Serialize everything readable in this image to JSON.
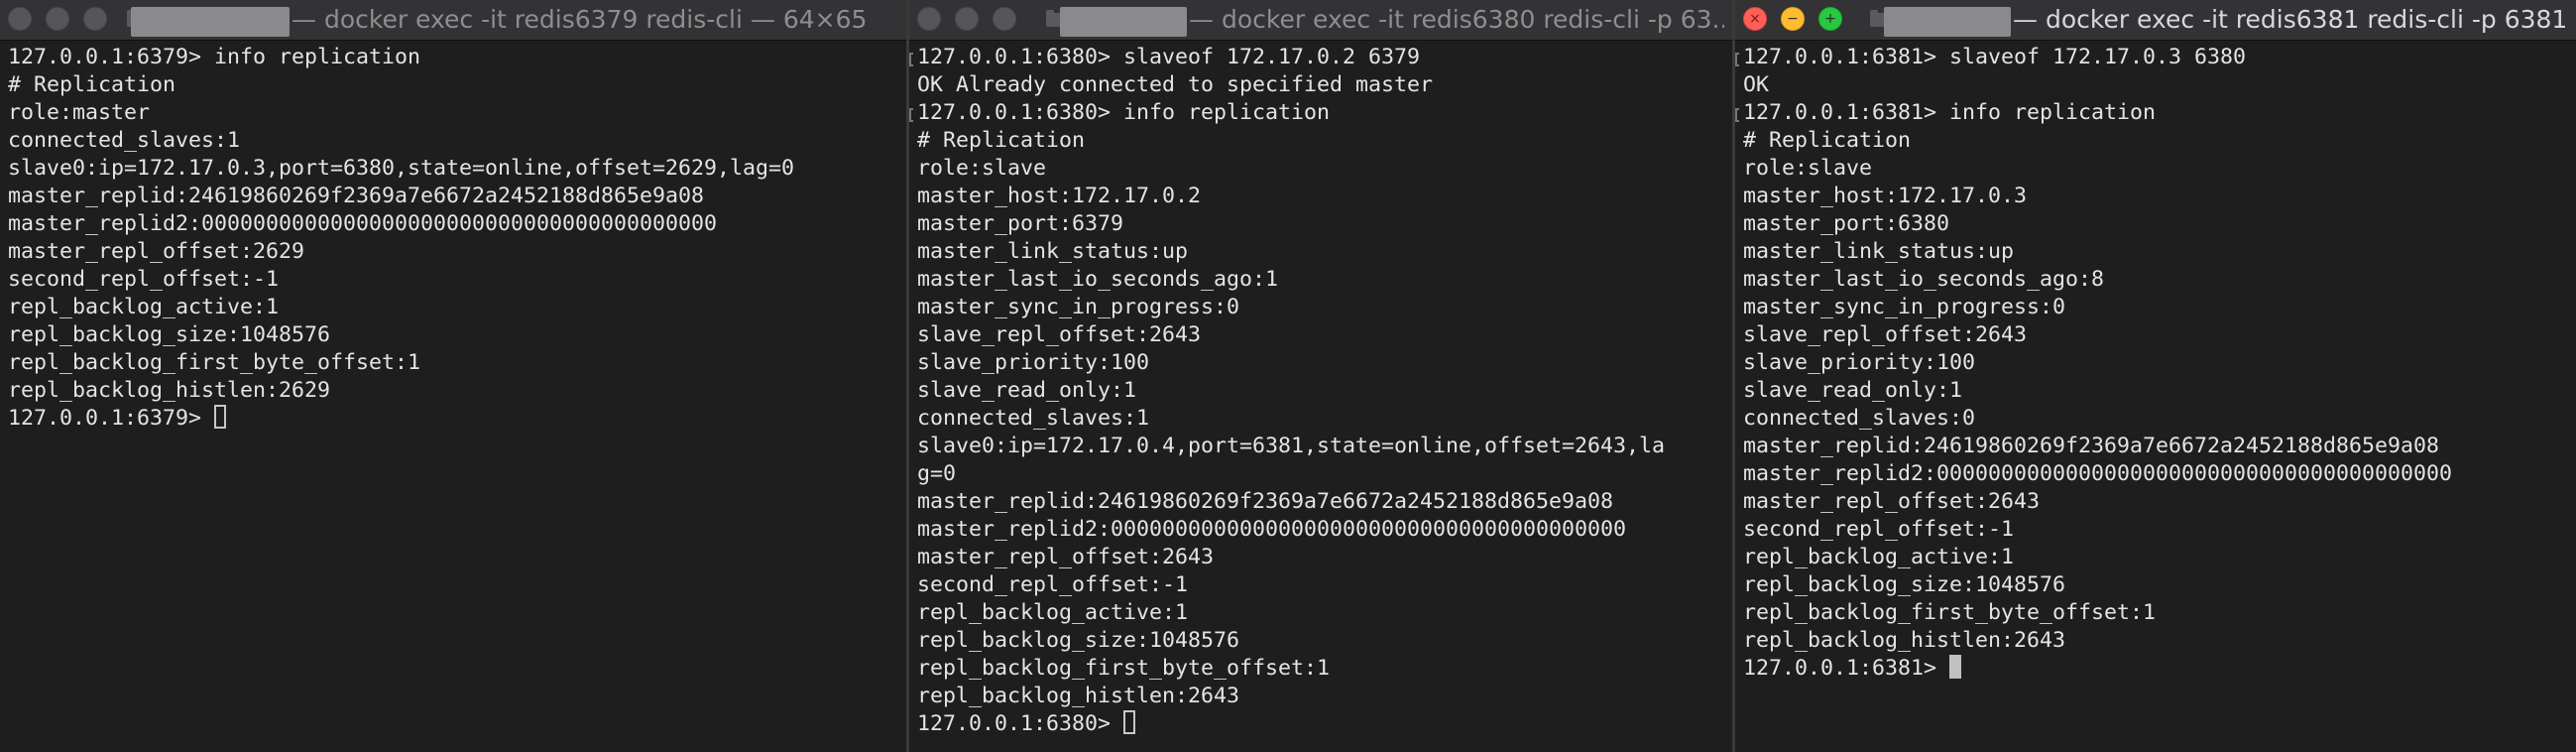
{
  "windows": [
    {
      "title": "— docker exec -it redis6379 redis-cli — 64×65",
      "active": false,
      "lines": [
        "127.0.0.1:6379> info replication",
        "# Replication",
        "role:master",
        "connected_slaves:1",
        "slave0:ip=172.17.0.3,port=6380,state=online,offset=2629,lag=0",
        "master_replid:24619860269f2369a7e6672a2452188d865e9a08",
        "master_replid2:0000000000000000000000000000000000000000",
        "master_repl_offset:2629",
        "second_repl_offset:-1",
        "repl_backlog_active:1",
        "repl_backlog_size:1048576",
        "repl_backlog_first_byte_offset:1",
        "repl_backlog_histlen:2629"
      ],
      "prompt": "127.0.0.1:6379> "
    },
    {
      "title": "— docker exec -it redis6380 redis-cli -p 63...",
      "active": false,
      "lines": [
        "127.0.0.1:6380> slaveof 172.17.0.2 6379",
        "OK Already connected to specified master",
        "127.0.0.1:6380> info replication",
        "# Replication",
        "role:slave",
        "master_host:172.17.0.2",
        "master_port:6379",
        "master_link_status:up",
        "master_last_io_seconds_ago:1",
        "master_sync_in_progress:0",
        "slave_repl_offset:2643",
        "slave_priority:100",
        "slave_read_only:1",
        "connected_slaves:1",
        "slave0:ip=172.17.0.4,port=6381,state=online,offset=2643,la",
        "g=0",
        "master_replid:24619860269f2369a7e6672a2452188d865e9a08",
        "master_replid2:0000000000000000000000000000000000000000",
        "master_repl_offset:2643",
        "second_repl_offset:-1",
        "repl_backlog_active:1",
        "repl_backlog_size:1048576",
        "repl_backlog_first_byte_offset:1",
        "repl_backlog_histlen:2643"
      ],
      "prompt": "127.0.0.1:6380> "
    },
    {
      "title": "— docker exec -it redis6381 redis-cli -p 6381...",
      "active": true,
      "lines": [
        "127.0.0.1:6381> slaveof 172.17.0.3 6380",
        "OK",
        "127.0.0.1:6381> info replication",
        "# Replication",
        "role:slave",
        "master_host:172.17.0.3",
        "master_port:6380",
        "master_link_status:up",
        "master_last_io_seconds_ago:8",
        "master_sync_in_progress:0",
        "slave_repl_offset:2643",
        "slave_priority:100",
        "slave_read_only:1",
        "connected_slaves:0",
        "master_replid:24619860269f2369a7e6672a2452188d865e9a08",
        "master_replid2:0000000000000000000000000000000000000000",
        "master_repl_offset:2643",
        "second_repl_offset:-1",
        "repl_backlog_active:1",
        "repl_backlog_size:1048576",
        "repl_backlog_first_byte_offset:1",
        "repl_backlog_histlen:2643"
      ],
      "prompt": "127.0.0.1:6381> "
    }
  ],
  "colors": {
    "background": "#1e1e1e",
    "text": "#e4e4e4",
    "titlebar": "#333335",
    "close": "#ff5f57",
    "minimize": "#febc2e",
    "zoom": "#28c840"
  }
}
